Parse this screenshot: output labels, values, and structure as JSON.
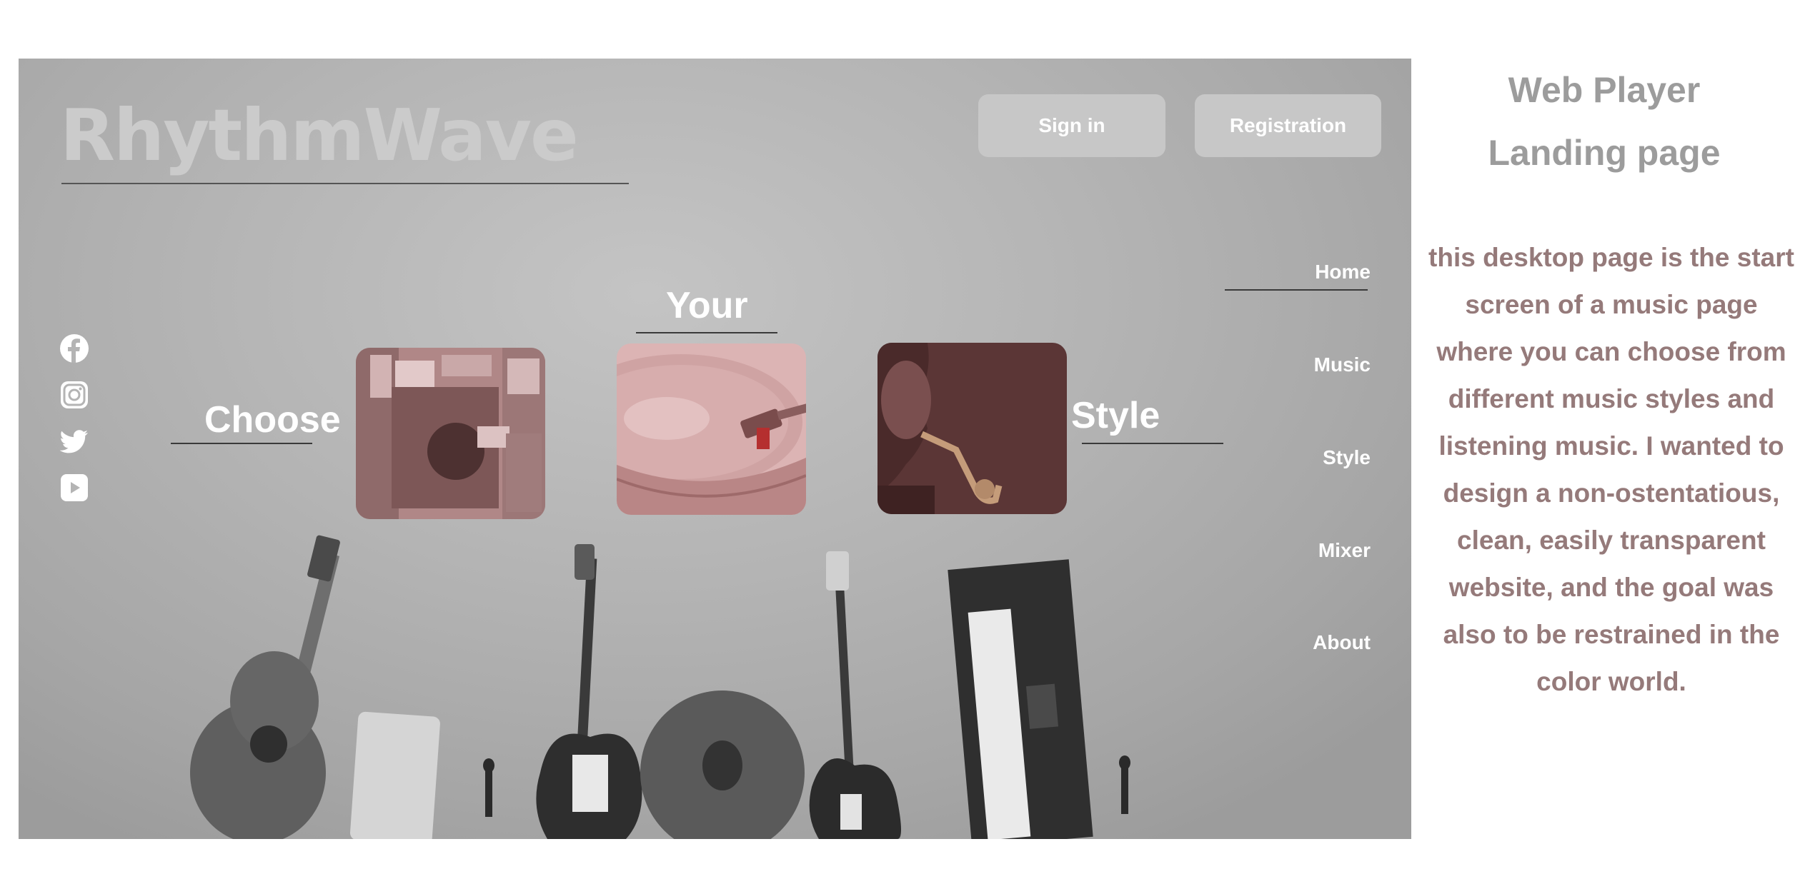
{
  "logo": "RhythmWave",
  "auth": {
    "sign_in": "Sign in",
    "registration": "Registration"
  },
  "nav": [
    "Home",
    "Music",
    "Style",
    "Mixer",
    "About"
  ],
  "nav_active": "Home",
  "headline": {
    "choose": "Choose",
    "your": "Your",
    "style": "Style"
  },
  "socials": [
    "facebook-icon",
    "instagram-icon",
    "twitter-icon",
    "youtube-icon"
  ],
  "cards": [
    {
      "name": "vinyl-records-browsing-card"
    },
    {
      "name": "turntable-card"
    },
    {
      "name": "saxophone-player-card"
    }
  ],
  "side": {
    "title_line1": "Web Player",
    "title_line2": "Landing page",
    "description": "this desktop page is the start screen of a music page where you can choose from different music styles and listening music. I wanted to design a non-ostentatious, clean, easily transparent website, and the goal was also to be restrained in the color world."
  },
  "colors": {
    "accent_text": "#957a7a",
    "title_gray": "#9c9c9c",
    "card_tint_light": "#d9b3b3",
    "card_tint_dark": "#5b3636"
  }
}
